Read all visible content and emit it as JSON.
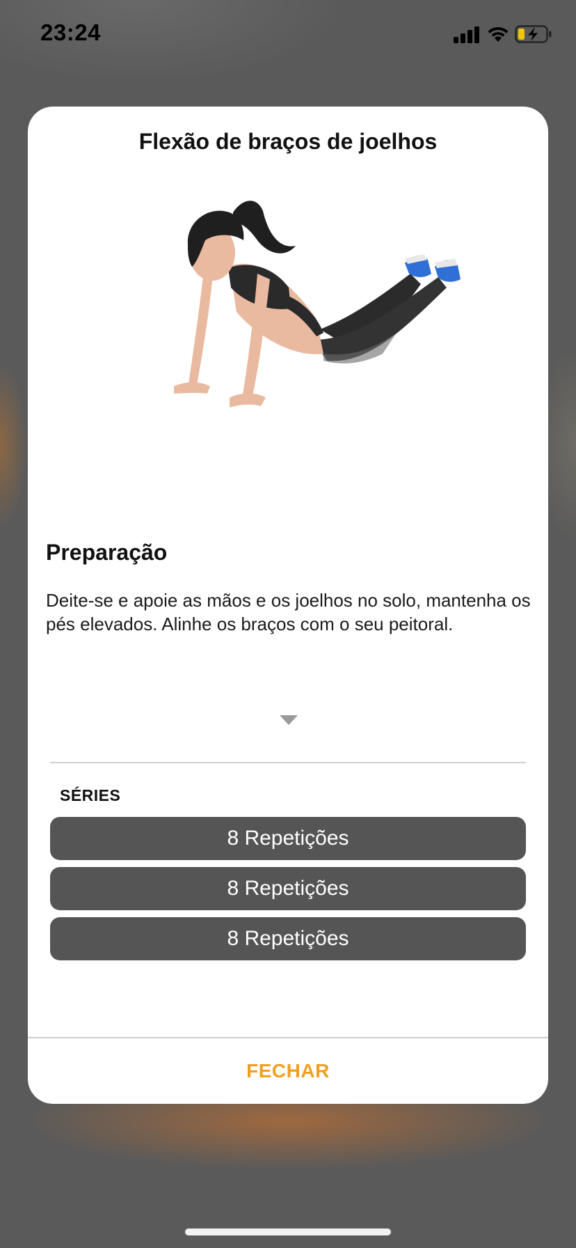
{
  "status_bar": {
    "time": "23:24"
  },
  "modal": {
    "title": "Flexão de braços de joelhos",
    "section_heading": "Preparação",
    "description": "Deite-se e apoie as mãos e os joelhos no solo, mantenha os pés elevados. Alinhe os braços com o seu peitoral.",
    "series_label": "SÉRIES",
    "series": [
      {
        "label": "8 Repetições"
      },
      {
        "label": "8 Repetições"
      },
      {
        "label": "8 Repetições"
      }
    ],
    "close_label": "FECHAR"
  },
  "colors": {
    "accent": "#f0a020",
    "series_button": "#555555",
    "backdrop": "#5a5a5a"
  },
  "icons": {
    "signal": "cellular-signal-icon",
    "wifi": "wifi-icon",
    "battery": "battery-charging-icon",
    "expand": "chevron-down-icon"
  }
}
